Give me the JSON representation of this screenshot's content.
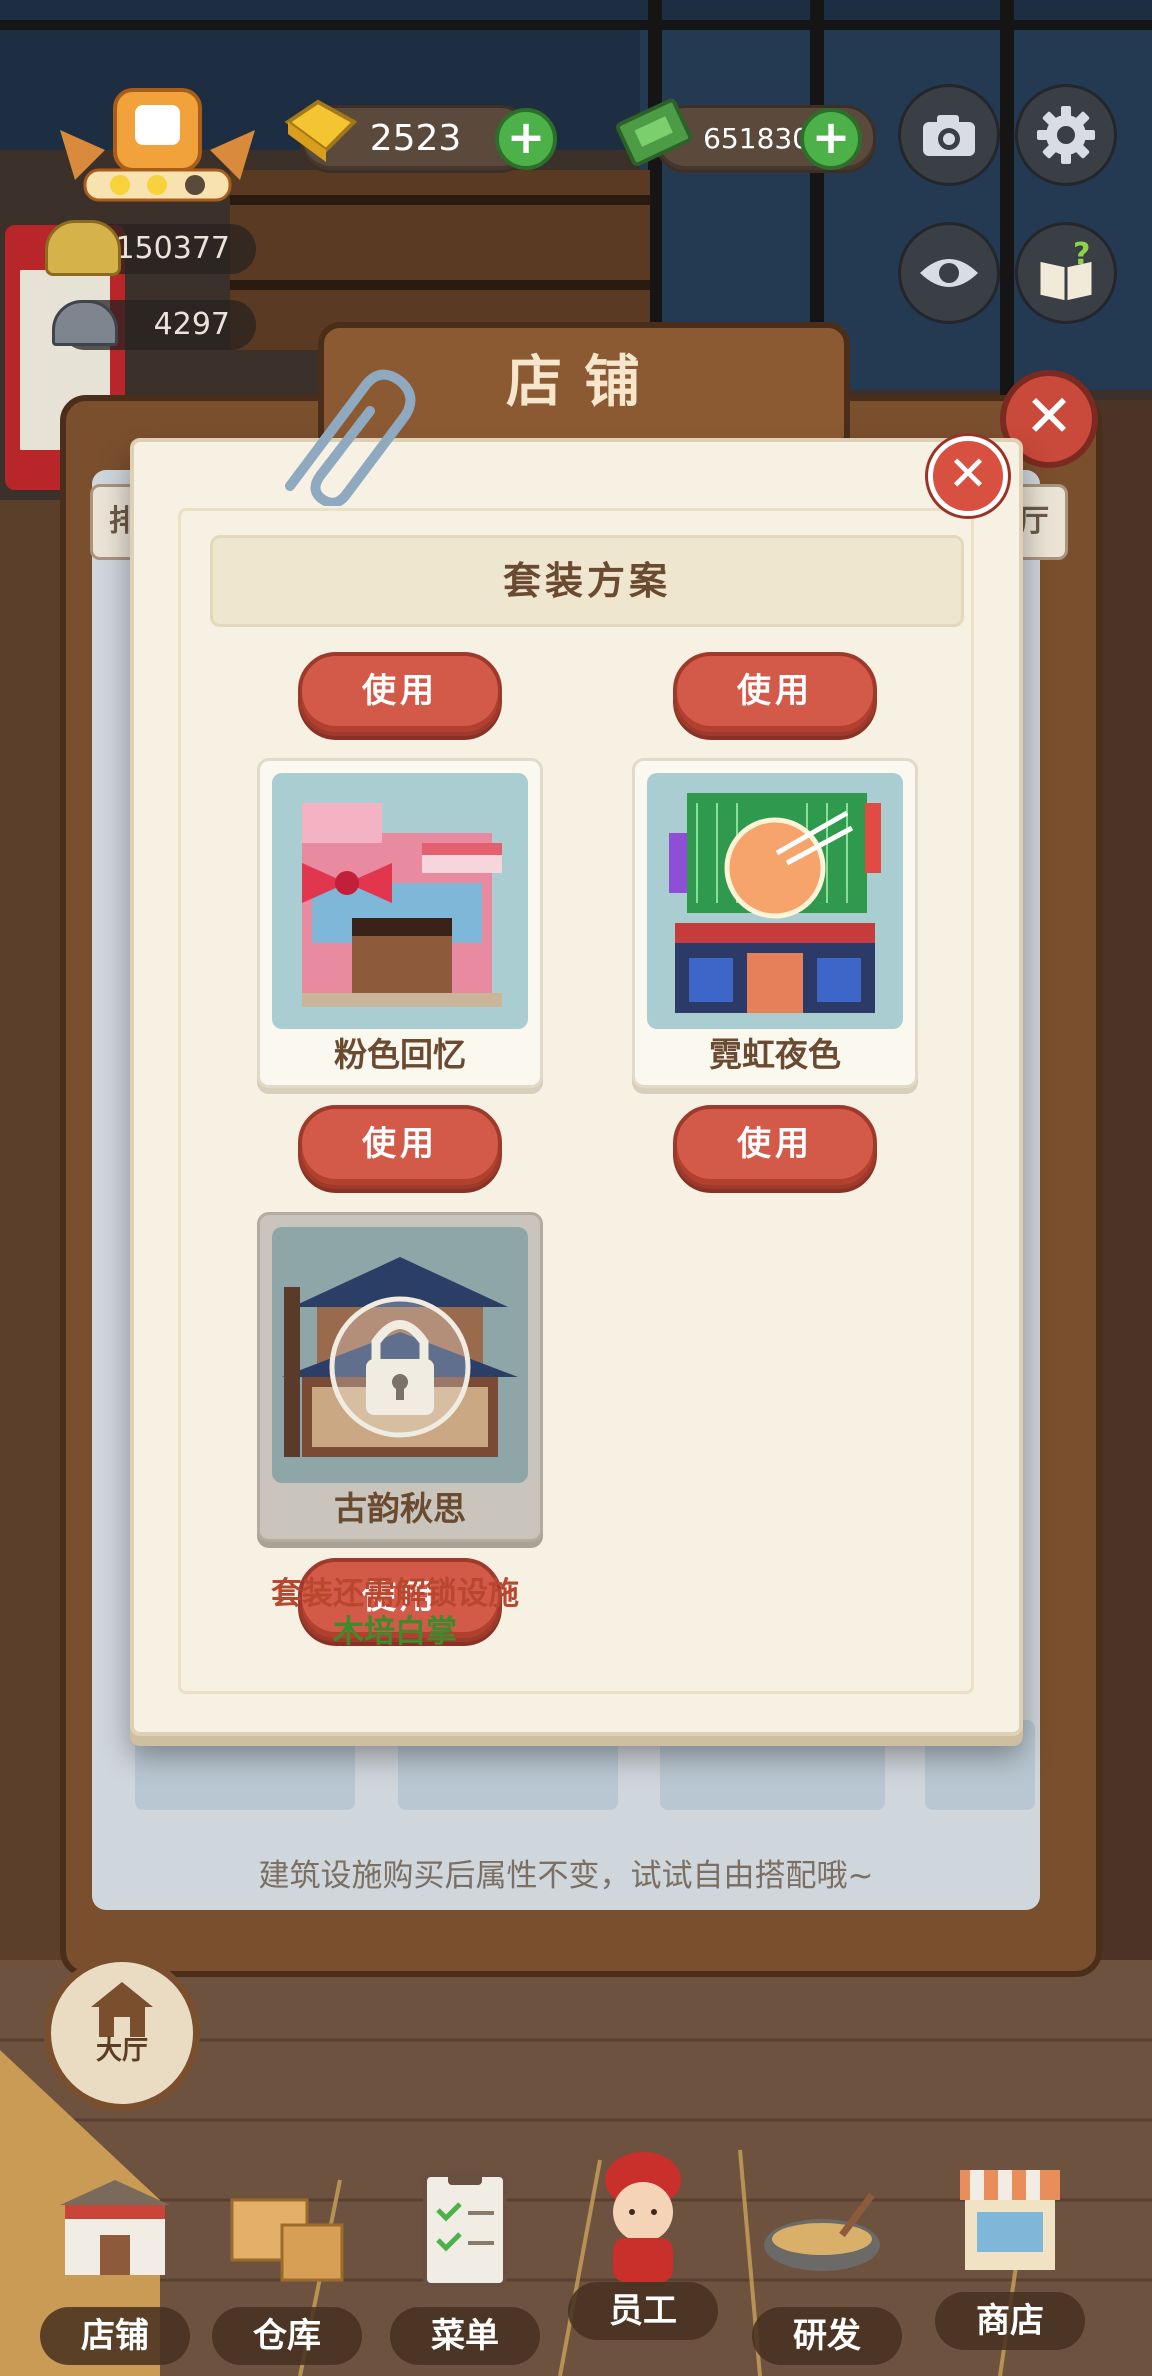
{
  "hud": {
    "gold": "2523",
    "cash": "6518302",
    "stat_1": "150377",
    "stat_2": "4297"
  },
  "shop": {
    "title": "店铺",
    "side_tab_left": "排",
    "side_tab_right": "厅",
    "hint": "建筑设施购买后属性不变，试试自由搭配哦~"
  },
  "dialog": {
    "title": "套装方案",
    "sets": [
      {
        "name": "粉色回忆",
        "button": "使用",
        "locked": false
      },
      {
        "name": "霓虹夜色",
        "button": "使用",
        "locked": false
      },
      {
        "name": "古韵秋思",
        "button": "使用",
        "locked": true
      }
    ],
    "lock_note_line1": "套装还需解锁设施",
    "lock_note_line2": "木培白掌"
  },
  "hall": {
    "label": "大厅"
  },
  "nav": [
    {
      "label": "店铺",
      "icon": "storefront-icon"
    },
    {
      "label": "仓库",
      "icon": "boxes-icon"
    },
    {
      "label": "菜单",
      "icon": "clipboard-icon"
    },
    {
      "label": "员工",
      "icon": "chef-girl-icon"
    },
    {
      "label": "研发",
      "icon": "wok-icon"
    },
    {
      "label": "商店",
      "icon": "shop-icon"
    }
  ],
  "colors": {
    "accent_red": "#d35a48",
    "plus_green": "#4db14a",
    "paper": "#f7f1e3",
    "wood": "#7a4f2e"
  }
}
